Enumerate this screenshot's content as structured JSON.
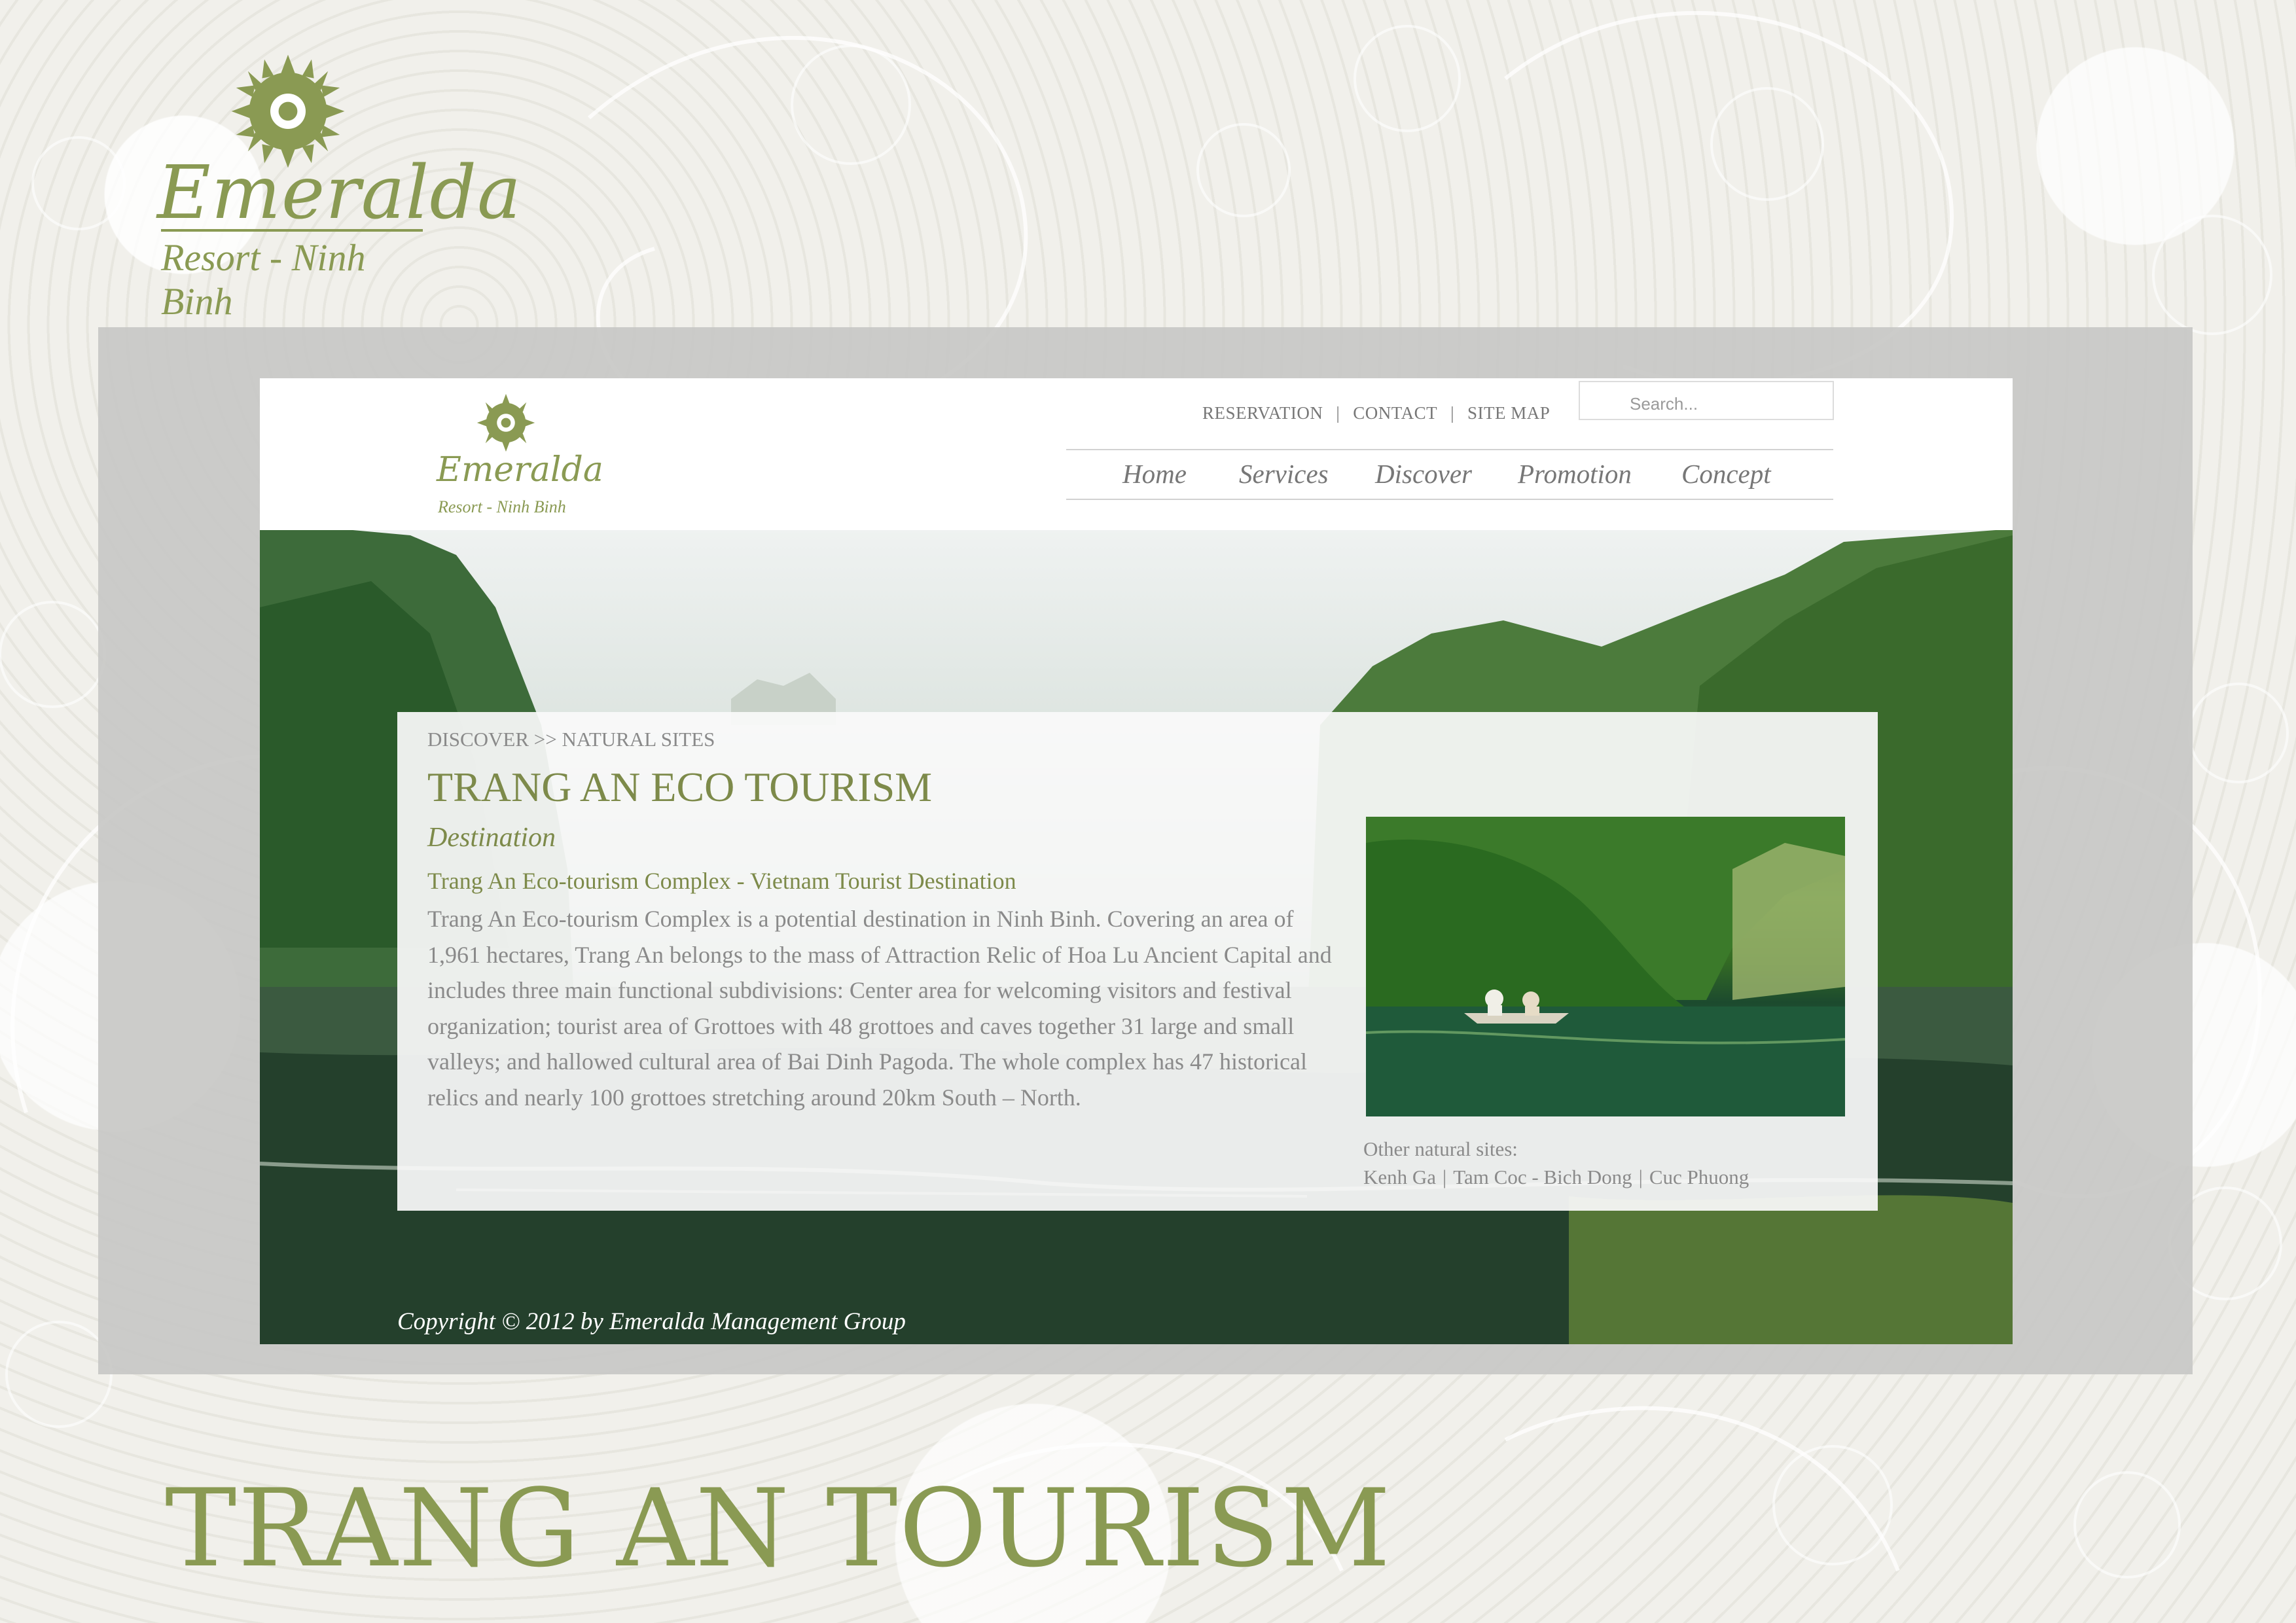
{
  "brand": {
    "name": "Emeralda",
    "subtitle": "Resort - Ninh Binh"
  },
  "site": {
    "logo": {
      "name": "Emeralda",
      "subtitle": "Resort - Ninh Binh"
    },
    "top_links": [
      "RESERVATION",
      "CONTACT",
      "SITE MAP"
    ],
    "search": {
      "placeholder": "Search..."
    },
    "nav": [
      "Home",
      "Services",
      "Discover",
      "Promotion",
      "Concept"
    ],
    "breadcrumb": "DISCOVER >> NATURAL SITES",
    "title": "TRANG AN ECO TOURISM",
    "section_label": "Destination",
    "subheading": "Trang An Eco-tourism Complex - Vietnam Tourist Destination",
    "body": "Trang An Eco-tourism Complex is a potential destination in Ninh Binh. Covering an area of 1,961 hectares, Trang An belongs to the mass of Attraction Relic of Hoa Lu Ancient Capital and includes three main functional subdivisions: Center area for welcoming visitors and festival organization; tourist area of Grottoes with 48 grottoes and caves together 31 large and small valleys; and hallowed cultural area of Bai Dinh Pagoda. The whole complex has 47 historical relics and nearly 100 grottoes stretching around 20km South – North.",
    "other_sites_label": "Other natural sites:",
    "other_sites": [
      "Kenh Ga",
      "Tam Coc - Bich Dong",
      "Cuc Phuong"
    ],
    "copyright": "Copyright © 2012 by Emeralda Management Group"
  },
  "slide_title": "TRANG AN TOURISM",
  "colors": {
    "accent": "#8a9a53",
    "text_muted": "#8a8a8a"
  }
}
